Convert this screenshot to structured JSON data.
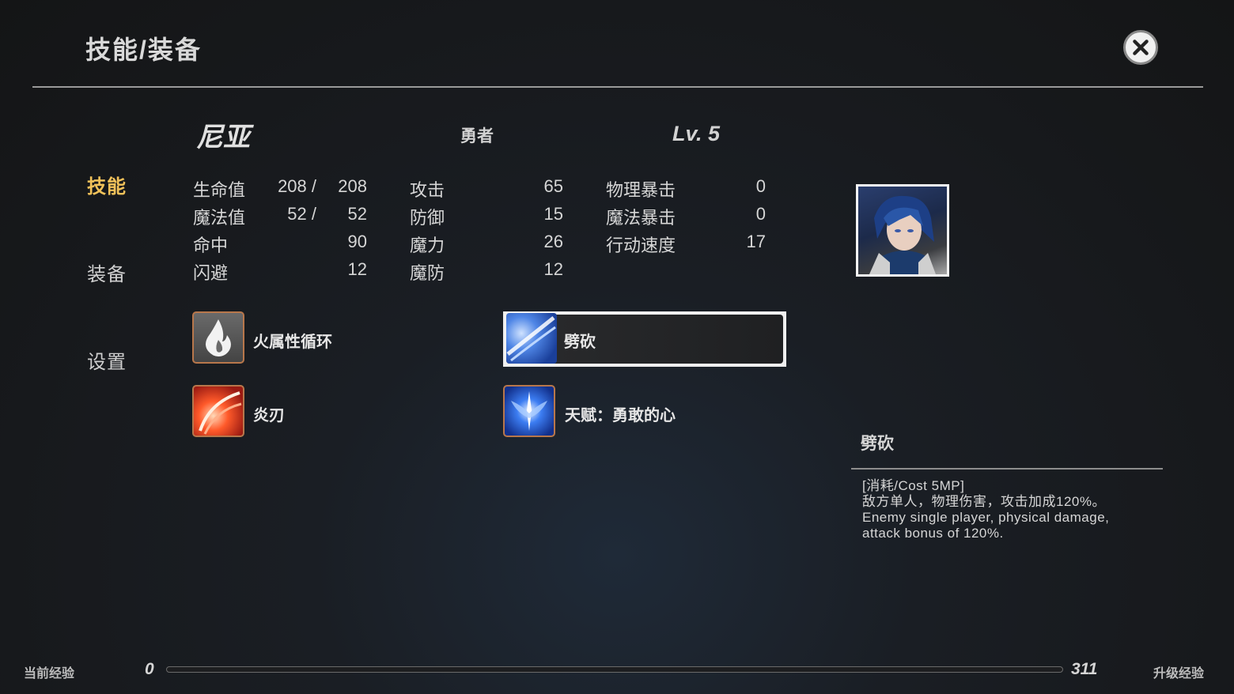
{
  "header": {
    "title": "技能/装备"
  },
  "nav": {
    "items": [
      {
        "label": "技能"
      },
      {
        "label": "装备"
      },
      {
        "label": "设置"
      }
    ]
  },
  "character": {
    "name": "尼亚",
    "class": "勇者",
    "level": "Lv. 5"
  },
  "stats": {
    "hp_label": "生命值",
    "hp_cur": "208 /",
    "hp_max": "208",
    "mp_label": "魔法值",
    "mp_cur": "52 /",
    "mp_max": "52",
    "hit_label": "命中",
    "hit": "90",
    "eva_label": "闪避",
    "eva": "12",
    "atk_label": "攻击",
    "atk": "65",
    "def_label": "防御",
    "def": "15",
    "mag_label": "魔力",
    "mag": "26",
    "mdef_label": "魔防",
    "mdef": "12",
    "pcrit_label": "物理暴击",
    "pcrit": "0",
    "mcrit_label": "魔法暴击",
    "mcrit": "0",
    "spd_label": "行动速度",
    "spd": "17"
  },
  "skills": [
    {
      "name": "火属性循环",
      "icon": "fire-icon"
    },
    {
      "name": "劈砍",
      "icon": "slash-icon"
    },
    {
      "name": "炎刃",
      "icon": "flame-blade-icon"
    },
    {
      "name": "天赋：勇敢的心",
      "icon": "brave-heart-icon"
    }
  ],
  "description": {
    "title": "劈砍",
    "text": "[消耗/Cost 5MP]\n敌方单人，物理伤害，攻击加成120%。\nEnemy single player, physical damage,\nattack bonus of 120%."
  },
  "exp": {
    "current_label": "当前经验",
    "current": "0",
    "next": "311",
    "next_label": "升级经验",
    "progress": 0
  }
}
